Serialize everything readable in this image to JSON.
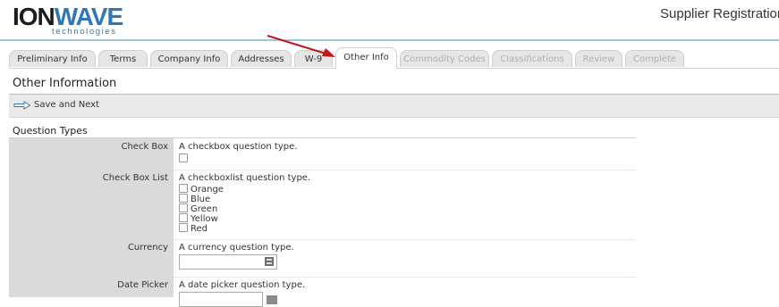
{
  "header": {
    "logo_ion": "ION",
    "logo_wave": "WAVE",
    "logo_sub": "technologies",
    "title": "Supplier Registration"
  },
  "tabs": [
    {
      "label": "Preliminary Info",
      "state": "normal"
    },
    {
      "label": "Terms",
      "state": "normal"
    },
    {
      "label": "Company Info",
      "state": "normal"
    },
    {
      "label": "Addresses",
      "state": "normal"
    },
    {
      "label": "W-9",
      "state": "normal"
    },
    {
      "label": "Other Info",
      "state": "active"
    },
    {
      "label": "Commodity Codes",
      "state": "disabled"
    },
    {
      "label": "Classifications",
      "state": "disabled"
    },
    {
      "label": "Review",
      "state": "disabled"
    },
    {
      "label": "Complete",
      "state": "disabled"
    }
  ],
  "page": {
    "title": "Other Information",
    "save_next_label": "Save and Next",
    "question_types_heading": "Question Types"
  },
  "questions": {
    "checkbox": {
      "label": "Check Box",
      "description": "A checkbox question type."
    },
    "checkboxlist": {
      "label": "Check Box List",
      "description": "A checkboxlist question type.",
      "options": [
        "Orange",
        "Blue",
        "Green",
        "Yellow",
        "Red"
      ]
    },
    "currency": {
      "label": "Currency",
      "description": "A currency question type.",
      "value": ""
    },
    "datepicker": {
      "label": "Date Picker",
      "description": "A date picker question type.",
      "value": ""
    }
  },
  "colors": {
    "accent": "#2e78b8",
    "arrow": "#c0181e",
    "label_bg": "#dadada",
    "toolbar_bg": "#e9e9e9"
  },
  "icons": {
    "save_next": "arrow-right-icon",
    "currency": "calculator-icon",
    "date": "calendar-icon"
  }
}
